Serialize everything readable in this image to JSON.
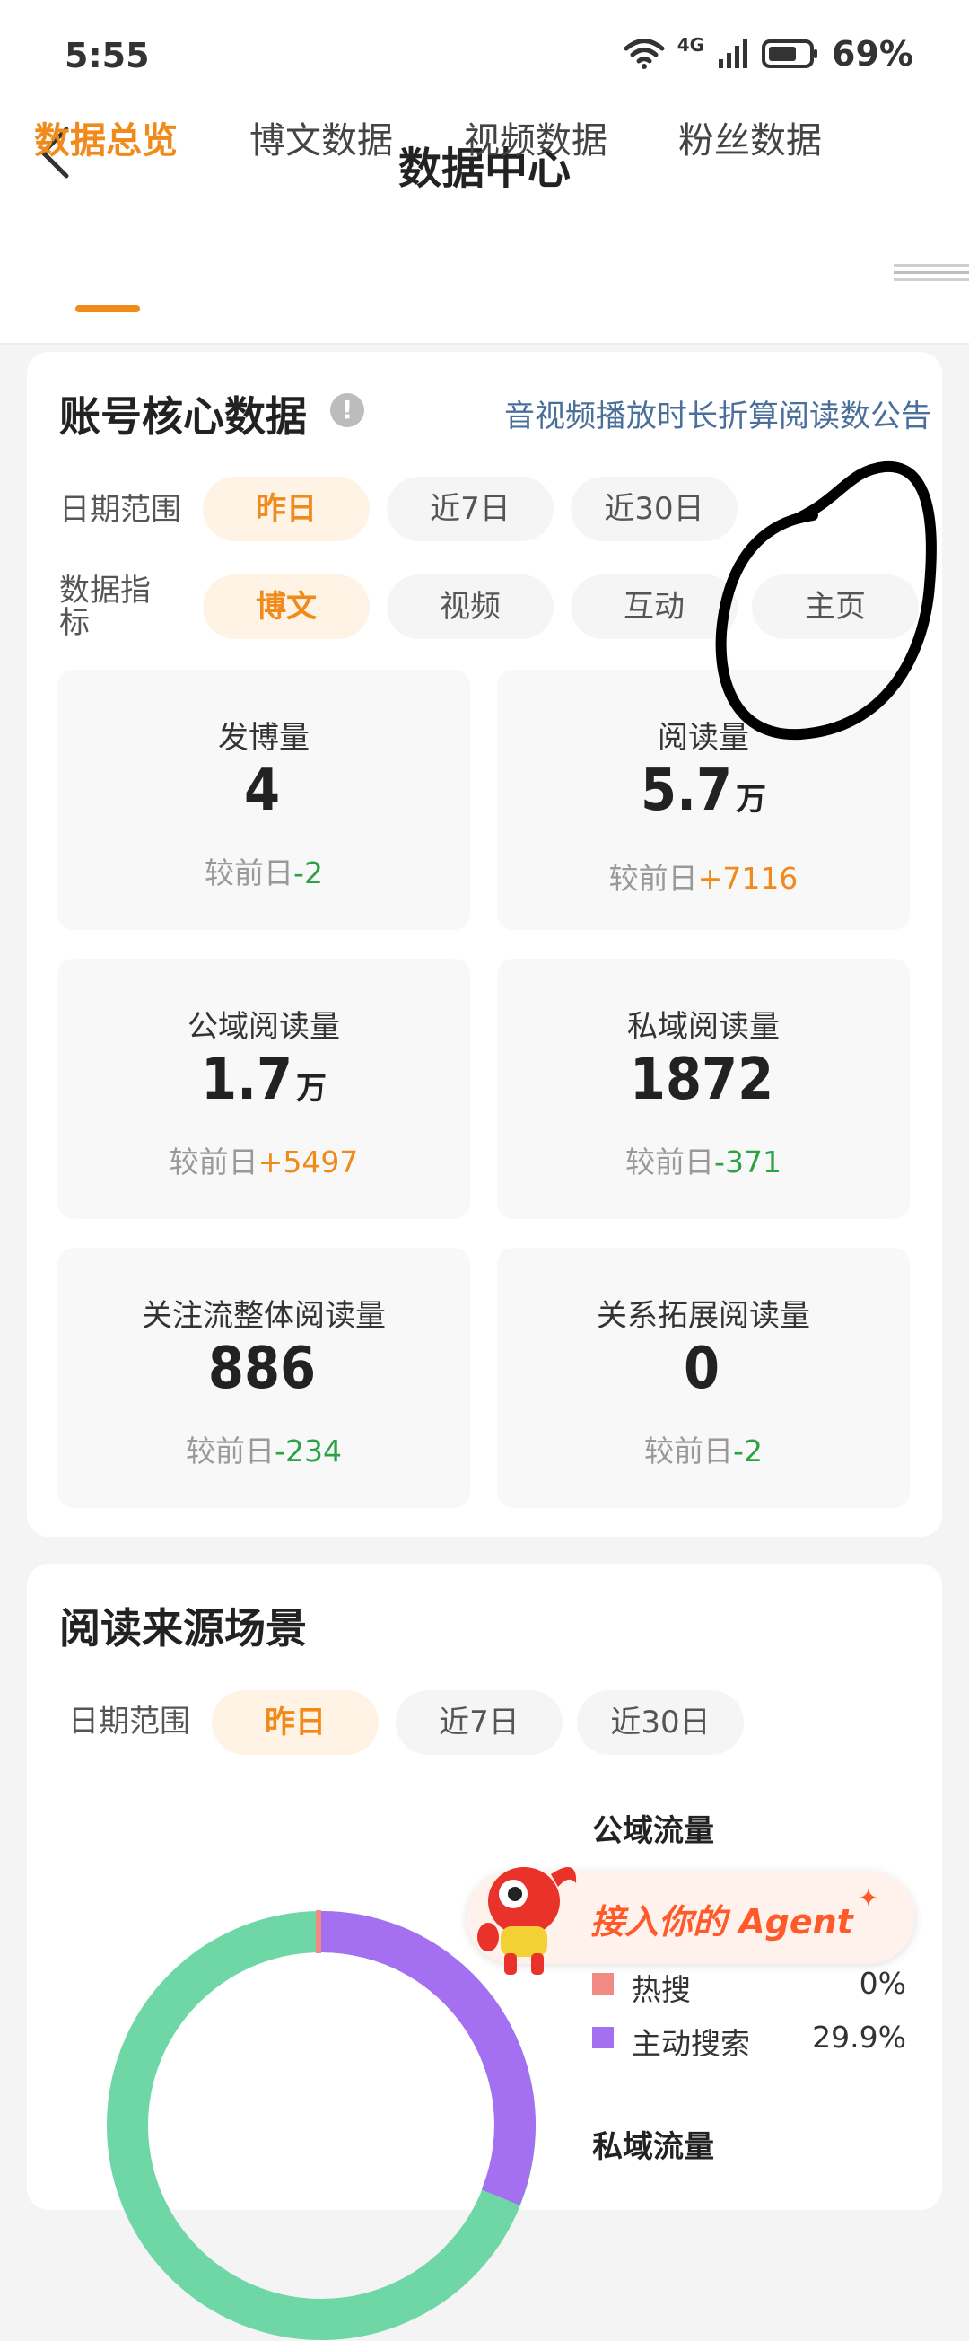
{
  "status_bar": {
    "time": "5:55",
    "network": "4G",
    "battery": "69%"
  },
  "header": {
    "title": "数据中心"
  },
  "tabs": [
    {
      "label": "数据总览",
      "active": true
    },
    {
      "label": "博文数据",
      "active": false
    },
    {
      "label": "视频数据",
      "active": false
    },
    {
      "label": "粉丝数据",
      "active": false
    }
  ],
  "core": {
    "title": "账号核心数据",
    "notice": "音视频播放时长折算阅读数公告",
    "date_label": "日期范围",
    "date_options": [
      "昨日",
      "近7日",
      "近30日"
    ],
    "metric_label": "数据指标",
    "metric_options": [
      "博文",
      "视频",
      "互动",
      "主页"
    ],
    "compare_prefix": "较前日",
    "metrics": [
      {
        "label": "发博量",
        "value": "4",
        "unit": "",
        "delta": "-2",
        "trend": "down"
      },
      {
        "label": "阅读量",
        "value": "5.7",
        "unit": "万",
        "delta": "+7116",
        "trend": "up"
      },
      {
        "label": "公域阅读量",
        "value": "1.7",
        "unit": "万",
        "delta": "+5497",
        "trend": "up"
      },
      {
        "label": "私域阅读量",
        "value": "1872",
        "unit": "",
        "delta": "-371",
        "trend": "down"
      },
      {
        "label": "关注流整体阅读量",
        "value": "886",
        "unit": "",
        "delta": "-234",
        "trend": "down"
      },
      {
        "label": "关系拓展阅读量",
        "value": "0",
        "unit": "",
        "delta": "-2",
        "trend": "down"
      }
    ]
  },
  "source": {
    "title": "阅读来源场景",
    "date_label": "日期范围",
    "date_options": [
      "昨日",
      "近7日",
      "近30日"
    ],
    "public_title": "公域流量",
    "private_title": "私域流量",
    "legend": [
      {
        "label": "热搜",
        "value": "0%",
        "color": "#f08a82"
      },
      {
        "label": "主动搜索",
        "value": "29.9%",
        "color": "#a46ff0"
      }
    ]
  },
  "agent_banner": {
    "text": "接入你的 Agent"
  },
  "colors": {
    "accent": "#f08a1a",
    "positive": "#f08a1a",
    "negative": "#2ba244"
  }
}
